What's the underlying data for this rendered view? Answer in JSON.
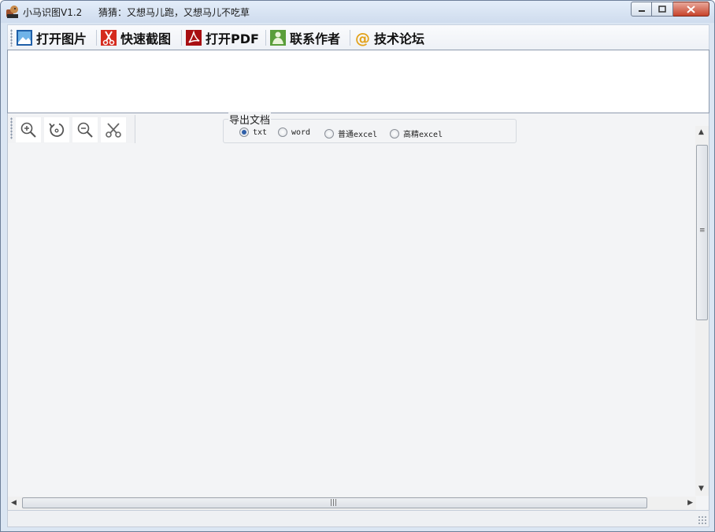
{
  "window": {
    "title": "小马识图V1.2",
    "subtitle": "猜猜：又想马儿跑，又想马儿不吃草"
  },
  "toolbar": {
    "items": [
      {
        "label": "打开图片",
        "icon": "image-icon"
      },
      {
        "label": "快速截图",
        "icon": "scissors-icon"
      },
      {
        "label": "打开PDF",
        "icon": "pdf-icon"
      },
      {
        "label": "联系作者",
        "icon": "contact-icon"
      },
      {
        "label": "技术论坛",
        "icon": "at-icon"
      }
    ]
  },
  "image_tools": [
    "zoom-in-icon",
    "rotate-icon",
    "zoom-out-icon",
    "crop-scissors-icon"
  ],
  "export": {
    "legend": "导出文档",
    "options": [
      {
        "label": "txt",
        "checked": true
      },
      {
        "label": "word",
        "checked": false
      },
      {
        "label": "普通excel",
        "checked": false
      },
      {
        "label": "高精excel",
        "checked": false
      }
    ]
  },
  "scrollbar": {
    "thumb_grip": "≡",
    "h_thumb_grip": "|||"
  },
  "colors": {
    "window_frame": "#dbe6f3",
    "close_button": "#c7432b",
    "radio_selected": "#2f5fa8"
  }
}
